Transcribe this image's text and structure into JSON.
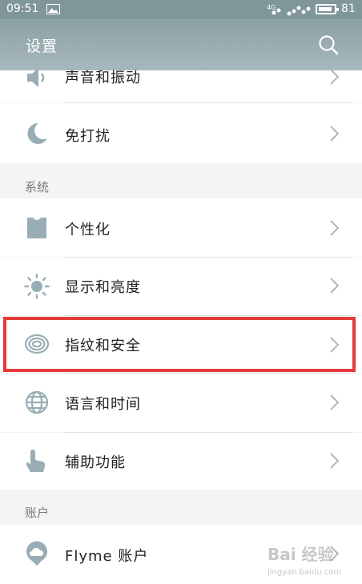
{
  "statusbar": {
    "time": "09:51",
    "battery_percent": "81",
    "network_label": "4G"
  },
  "header": {
    "title": "设置"
  },
  "rows": {
    "sound": {
      "label": "声音和振动",
      "icon": "speaker-icon"
    },
    "dnd": {
      "label": "免打扰",
      "icon": "moon-icon"
    },
    "personalize": {
      "label": "个性化",
      "icon": "shirt-icon"
    },
    "display": {
      "label": "显示和亮度",
      "icon": "sun-icon"
    },
    "fingerprint": {
      "label": "指纹和安全",
      "icon": "fingerprint-icon"
    },
    "language": {
      "label": "语言和时间",
      "icon": "globe-icon"
    },
    "accessibility": {
      "label": "辅助功能",
      "icon": "hand-icon"
    },
    "flyme": {
      "label": "Flyme 账户",
      "icon": "cloud-pin-icon"
    }
  },
  "sections": {
    "system": "系统",
    "account": "账户"
  },
  "watermark": {
    "text": "Bai 经验",
    "subtext": "jingyan.baidu.com"
  },
  "colors": {
    "header": "#8ca1a6",
    "icon": "#98aeb4",
    "highlight": "#e33b3b"
  }
}
